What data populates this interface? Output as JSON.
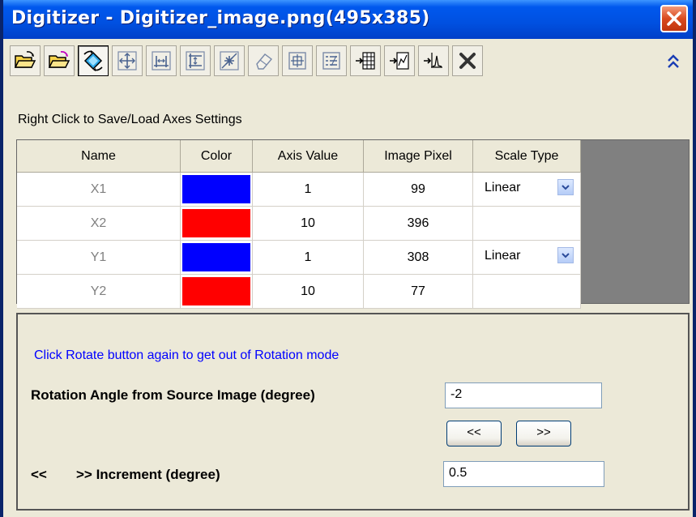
{
  "window": {
    "title": "Digitizer - Digitizer_image.png(495x385)"
  },
  "toolbar": {
    "buttons": [
      {
        "icon": "open-folder-icon",
        "active": false
      },
      {
        "icon": "open-folder-alt-icon",
        "active": false
      },
      {
        "icon": "rotate-image-icon",
        "active": true
      },
      {
        "icon": "move-axes-icon",
        "active": false
      },
      {
        "icon": "x-axis-icon",
        "active": false
      },
      {
        "icon": "y-axis-icon",
        "active": false
      },
      {
        "icon": "add-point-icon",
        "active": false
      },
      {
        "icon": "eraser-icon",
        "active": false
      },
      {
        "icon": "zoom-point-icon",
        "active": false
      },
      {
        "icon": "data-list-icon",
        "active": false
      },
      {
        "icon": "export-table-icon",
        "active": false
      },
      {
        "icon": "export-chart-icon",
        "active": false
      },
      {
        "icon": "export-peak-icon",
        "active": false
      },
      {
        "icon": "delete-icon",
        "active": false
      }
    ],
    "collapse_icon": "double-chevron-up-icon"
  },
  "hint": "Right Click to Save/Load Axes Settings",
  "axes_table": {
    "headers": [
      "Name",
      "Color",
      "Axis Value",
      "Image Pixel",
      "Scale Type"
    ],
    "rows": [
      {
        "name": "X1",
        "color": "#0000ff",
        "axis_value": "1",
        "image_pixel": "99",
        "scale_type": "Linear"
      },
      {
        "name": "X2",
        "color": "#ff0000",
        "axis_value": "10",
        "image_pixel": "396",
        "scale_type": ""
      },
      {
        "name": "Y1",
        "color": "#0000ff",
        "axis_value": "1",
        "image_pixel": "308",
        "scale_type": "Linear"
      },
      {
        "name": "Y2",
        "color": "#ff0000",
        "axis_value": "10",
        "image_pixel": "77",
        "scale_type": ""
      }
    ]
  },
  "rotation": {
    "hint": "Click Rotate button again to get out of Rotation mode",
    "angle_label": "Rotation Angle from Source Image (degree)",
    "angle_value": "-2",
    "prev_label": "<<",
    "next_label": ">>",
    "increment_prefix": "<<",
    "increment_label": ">> Increment (degree)",
    "increment_value": "0.5"
  },
  "colors": {
    "title_bar": "#0054e3",
    "close_button": "#d94a1f",
    "hint_text": "#0000ff",
    "panel_bg": "#ece9d8"
  }
}
